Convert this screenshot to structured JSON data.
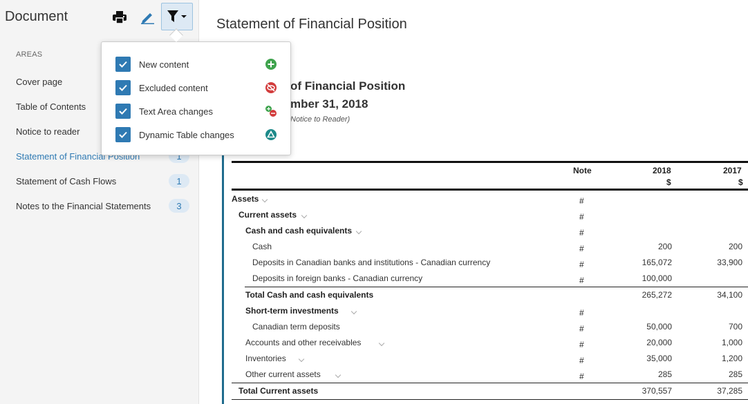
{
  "sidebar": {
    "title": "Document",
    "areas_label": "AREAS",
    "items": [
      {
        "label": "Cover page",
        "badge": ""
      },
      {
        "label": "Table of Contents",
        "badge": ""
      },
      {
        "label": "Notice to reader",
        "badge": ""
      },
      {
        "label": "Statement of Financial Position",
        "badge": "1"
      },
      {
        "label": "Statement of Cash Flows",
        "badge": "1"
      },
      {
        "label": "Notes to the Financial Statements",
        "badge": "3"
      }
    ]
  },
  "toolbar": {
    "print_icon": "print-icon",
    "edit_icon": "pencil-icon",
    "filter_icon": "filter-icon"
  },
  "filter_popup": {
    "options": [
      {
        "label": "New content",
        "checked": true,
        "icon": "plus-circle-icon",
        "color": "#3fa34d"
      },
      {
        "label": "Excluded content",
        "checked": true,
        "icon": "eye-slash-icon",
        "color": "#d23c3c"
      },
      {
        "label": "Text Area changes",
        "checked": true,
        "icon": "plus-minus-icon",
        "color": "#3fa34d"
      },
      {
        "label": "Dynamic Table changes",
        "checked": true,
        "icon": "triangle-circle-icon",
        "color": "#1d8a8a"
      }
    ]
  },
  "main": {
    "page_title": "Statement of Financial Position",
    "doc_heading_1": "of Financial Position",
    "doc_heading_2": "mber 31, 2018",
    "doc_subheading": "Notice to Reader)",
    "table": {
      "col_note": "Note",
      "col_2018": "2018",
      "col_2017": "2017",
      "currency_2018": "$",
      "currency_2017": "$",
      "rows": [
        {
          "label": "Assets",
          "note": "#",
          "v2018": "",
          "v2017": ""
        },
        {
          "label": "Current assets",
          "note": "#",
          "v2018": "",
          "v2017": ""
        },
        {
          "label": "Cash and cash equivalents",
          "note": "#",
          "v2018": "",
          "v2017": ""
        },
        {
          "label": "Cash",
          "note": "#",
          "v2018": "200",
          "v2017": "200"
        },
        {
          "label": "Deposits in Canadian banks and institutions - Canadian currency",
          "note": "#",
          "v2018": "165,072",
          "v2017": "33,900"
        },
        {
          "label": "Deposits in foreign banks - Canadian currency",
          "note": "#",
          "v2018": "100,000",
          "v2017": ""
        },
        {
          "label": "Total Cash and cash equivalents",
          "note": "",
          "v2018": "265,272",
          "v2017": "34,100"
        },
        {
          "label": "Short-term investments",
          "note": "#",
          "v2018": "",
          "v2017": ""
        },
        {
          "label": "Canadian term deposits",
          "note": "#",
          "v2018": "50,000",
          "v2017": "700"
        },
        {
          "label": "Accounts and other receivables",
          "note": "#",
          "v2018": "20,000",
          "v2017": "1,000"
        },
        {
          "label": "Inventories",
          "note": "#",
          "v2018": "35,000",
          "v2017": "1,200"
        },
        {
          "label": "Other current assets",
          "note": "#",
          "v2018": "285",
          "v2017": "285"
        },
        {
          "label": "Total Current assets",
          "note": "",
          "v2018": "370,557",
          "v2017": "37,285"
        }
      ]
    }
  }
}
